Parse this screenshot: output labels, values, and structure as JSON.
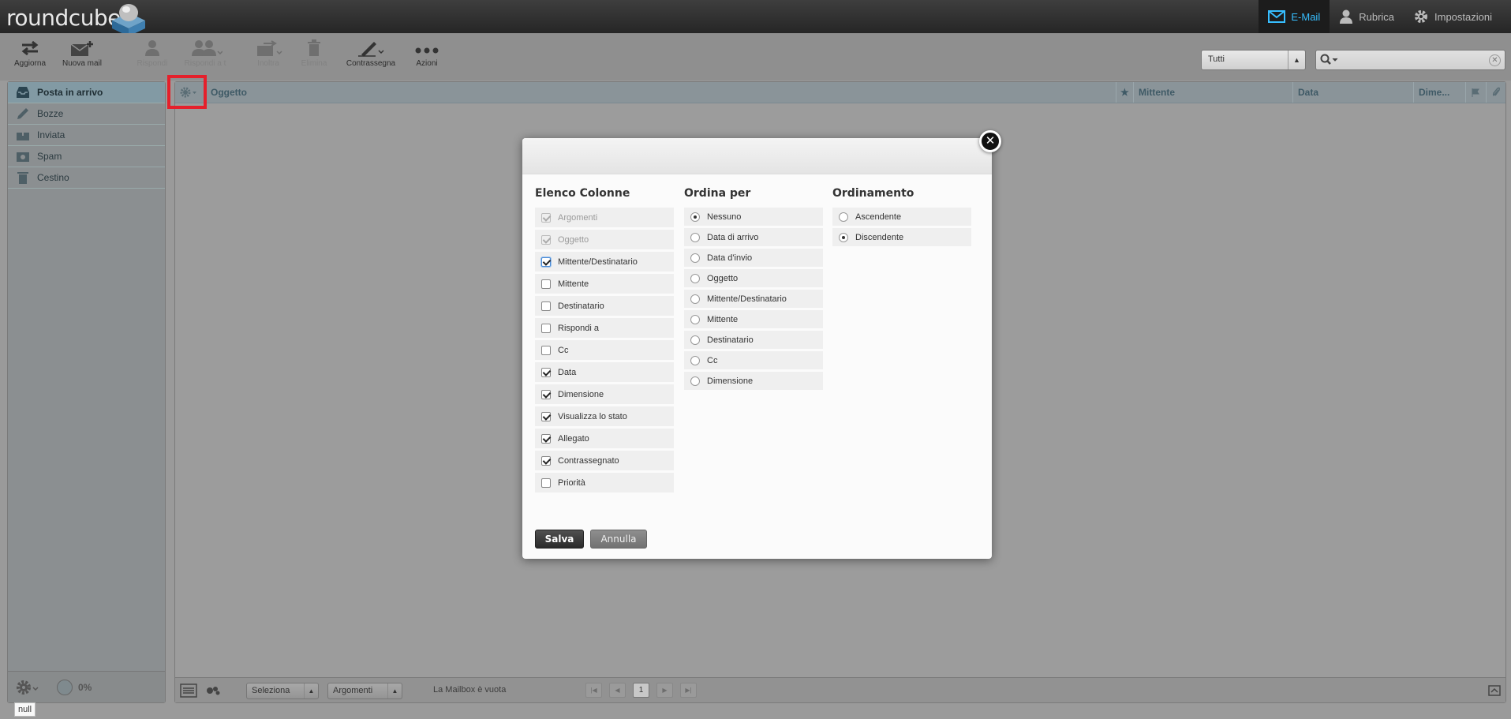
{
  "app": {
    "logo_text": "roundcube"
  },
  "topnav": {
    "mail": "E-Mail",
    "contacts": "Rubrica",
    "settings": "Impostazioni"
  },
  "toolbar": {
    "refresh": "Aggiorna",
    "compose": "Nuova mail",
    "reply": "Rispondi",
    "reply_all": "Rispondi a t",
    "forward": "Inoltra",
    "delete": "Elimina",
    "mark": "Contrassegna",
    "more": "Azioni"
  },
  "filter": {
    "selected": "Tutti"
  },
  "folders": [
    {
      "name": "Posta in arrivo",
      "icon": "inbox-icon",
      "selected": true
    },
    {
      "name": "Bozze",
      "icon": "pencil-icon"
    },
    {
      "name": "Inviata",
      "icon": "sent-icon"
    },
    {
      "name": "Spam",
      "icon": "spam-icon"
    },
    {
      "name": "Cestino",
      "icon": "trash-icon"
    }
  ],
  "quota": {
    "value": "0%"
  },
  "tooltip": "null",
  "message_list": {
    "columns": {
      "subject": "Oggetto",
      "from": "Mittente",
      "date": "Data",
      "size": "Dime..."
    },
    "footer": {
      "select": "Seleziona",
      "threads": "Argomenti",
      "status": "La Mailbox è vuota",
      "page": "1"
    }
  },
  "dialog": {
    "columns_title": "Elenco Colonne",
    "sortby_title": "Ordina per",
    "order_title": "Ordinamento",
    "columns": [
      {
        "label": "Argomenti",
        "checked": true,
        "disabled": true
      },
      {
        "label": "Oggetto",
        "checked": true,
        "disabled": true
      },
      {
        "label": "Mittente/Destinatario",
        "checked": true,
        "focus": true
      },
      {
        "label": "Mittente",
        "checked": false
      },
      {
        "label": "Destinatario",
        "checked": false
      },
      {
        "label": "Rispondi a",
        "checked": false
      },
      {
        "label": "Cc",
        "checked": false
      },
      {
        "label": "Data",
        "checked": true
      },
      {
        "label": "Dimensione",
        "checked": true
      },
      {
        "label": "Visualizza lo stato",
        "checked": true
      },
      {
        "label": "Allegato",
        "checked": true
      },
      {
        "label": "Contrassegnato",
        "checked": true
      },
      {
        "label": "Priorità",
        "checked": false
      }
    ],
    "sortby": [
      {
        "label": "Nessuno",
        "selected": true
      },
      {
        "label": "Data di arrivo"
      },
      {
        "label": "Data d'invio"
      },
      {
        "label": "Oggetto"
      },
      {
        "label": "Mittente/Destinatario"
      },
      {
        "label": "Mittente"
      },
      {
        "label": "Destinatario"
      },
      {
        "label": "Cc"
      },
      {
        "label": "Dimensione"
      }
    ],
    "order": [
      {
        "label": "Ascendente"
      },
      {
        "label": "Discendente",
        "selected": true
      }
    ],
    "save": "Salva",
    "cancel": "Annulla"
  },
  "colors": {
    "accent": "#37beff",
    "highlight": "#e5202b"
  }
}
